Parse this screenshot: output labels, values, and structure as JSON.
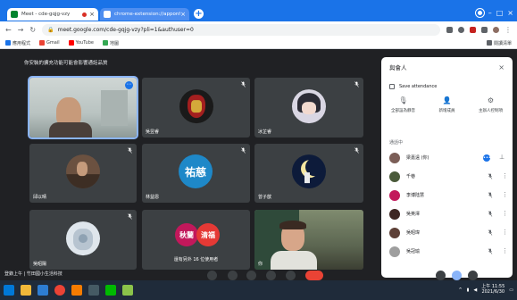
{
  "browser": {
    "tabs": [
      {
        "title": "Meet - cde-gqjg-vzy",
        "active": true
      },
      {
        "title": "chrome-extension://apponhol",
        "active": false
      }
    ],
    "url": "meet.google.com/cde-gqjg-vzy?pli=1&authuser=0",
    "bookmarks": [
      {
        "label": "應用程式",
        "icon": "apps-grid-icon"
      },
      {
        "label": "Gmail",
        "icon": "gmail-icon"
      },
      {
        "label": "YouTube",
        "icon": "youtube-icon"
      },
      {
        "label": "地圖",
        "icon": "maps-icon"
      }
    ],
    "bookmarks_right": "閱讀清單"
  },
  "meeting": {
    "title": "你安裝的擴充功能可能會影響通話品質",
    "tiles": [
      {
        "name": "",
        "kind": "video-man",
        "muted": false,
        "highlight": true
      },
      {
        "name": "吳昱睿",
        "kind": "avatar-ironman",
        "muted": true
      },
      {
        "name": "冰芷睿",
        "kind": "avatar-anime",
        "muted": true
      },
      {
        "name": "邱以晴",
        "kind": "avatar-brown",
        "muted": true
      },
      {
        "name": "林益恩",
        "kind": "letter",
        "letter": "祐慈",
        "color": "#1e88c8",
        "muted": true
      },
      {
        "name": "曾子歆",
        "kind": "avatar-moon",
        "muted": true
      },
      {
        "name": "吳昭陽",
        "kind": "avatar-sketch",
        "muted": true
      },
      {
        "name": "還有另外 16 位使用者",
        "kind": "others",
        "others": [
          "秋蘭",
          "清福"
        ],
        "muted": false
      },
      {
        "name": "你",
        "kind": "video-self",
        "muted": false
      }
    ]
  },
  "panel": {
    "title": "與會人",
    "attendance": "Save attendance",
    "actions": [
      {
        "label": "全部設為靜音",
        "icon": "mic-off-icon"
      },
      {
        "label": "新增成員",
        "icon": "person-add-icon"
      },
      {
        "label": "主辦人控制項",
        "icon": "host-controls-icon"
      }
    ],
    "section": "通話中",
    "participants": [
      {
        "name": "梁嘉遠 (你)",
        "color": "#7b5e57",
        "state": "speaking"
      },
      {
        "name": "千巷",
        "color": "#4a5a3a",
        "state": "muted"
      },
      {
        "name": "李博陆慧",
        "color": "#c2185b",
        "state": "muted"
      },
      {
        "name": "吳英澤",
        "color": "#3e2723",
        "state": "muted"
      },
      {
        "name": "吳昭瑋",
        "color": "#5d4037",
        "state": "muted"
      },
      {
        "name": "吳冠瑜",
        "color": "#9e9e9e",
        "state": "muted"
      }
    ]
  },
  "taskbar": {
    "time": "上午 11:55",
    "date": "2021/6/30",
    "caption": "登錄上午 | 竹田國小生活科技"
  },
  "colors": {
    "accent": "#1a73e8",
    "meet_bg": "#202124",
    "tile_bg": "#3c4043",
    "end_call": "#ea4335"
  }
}
